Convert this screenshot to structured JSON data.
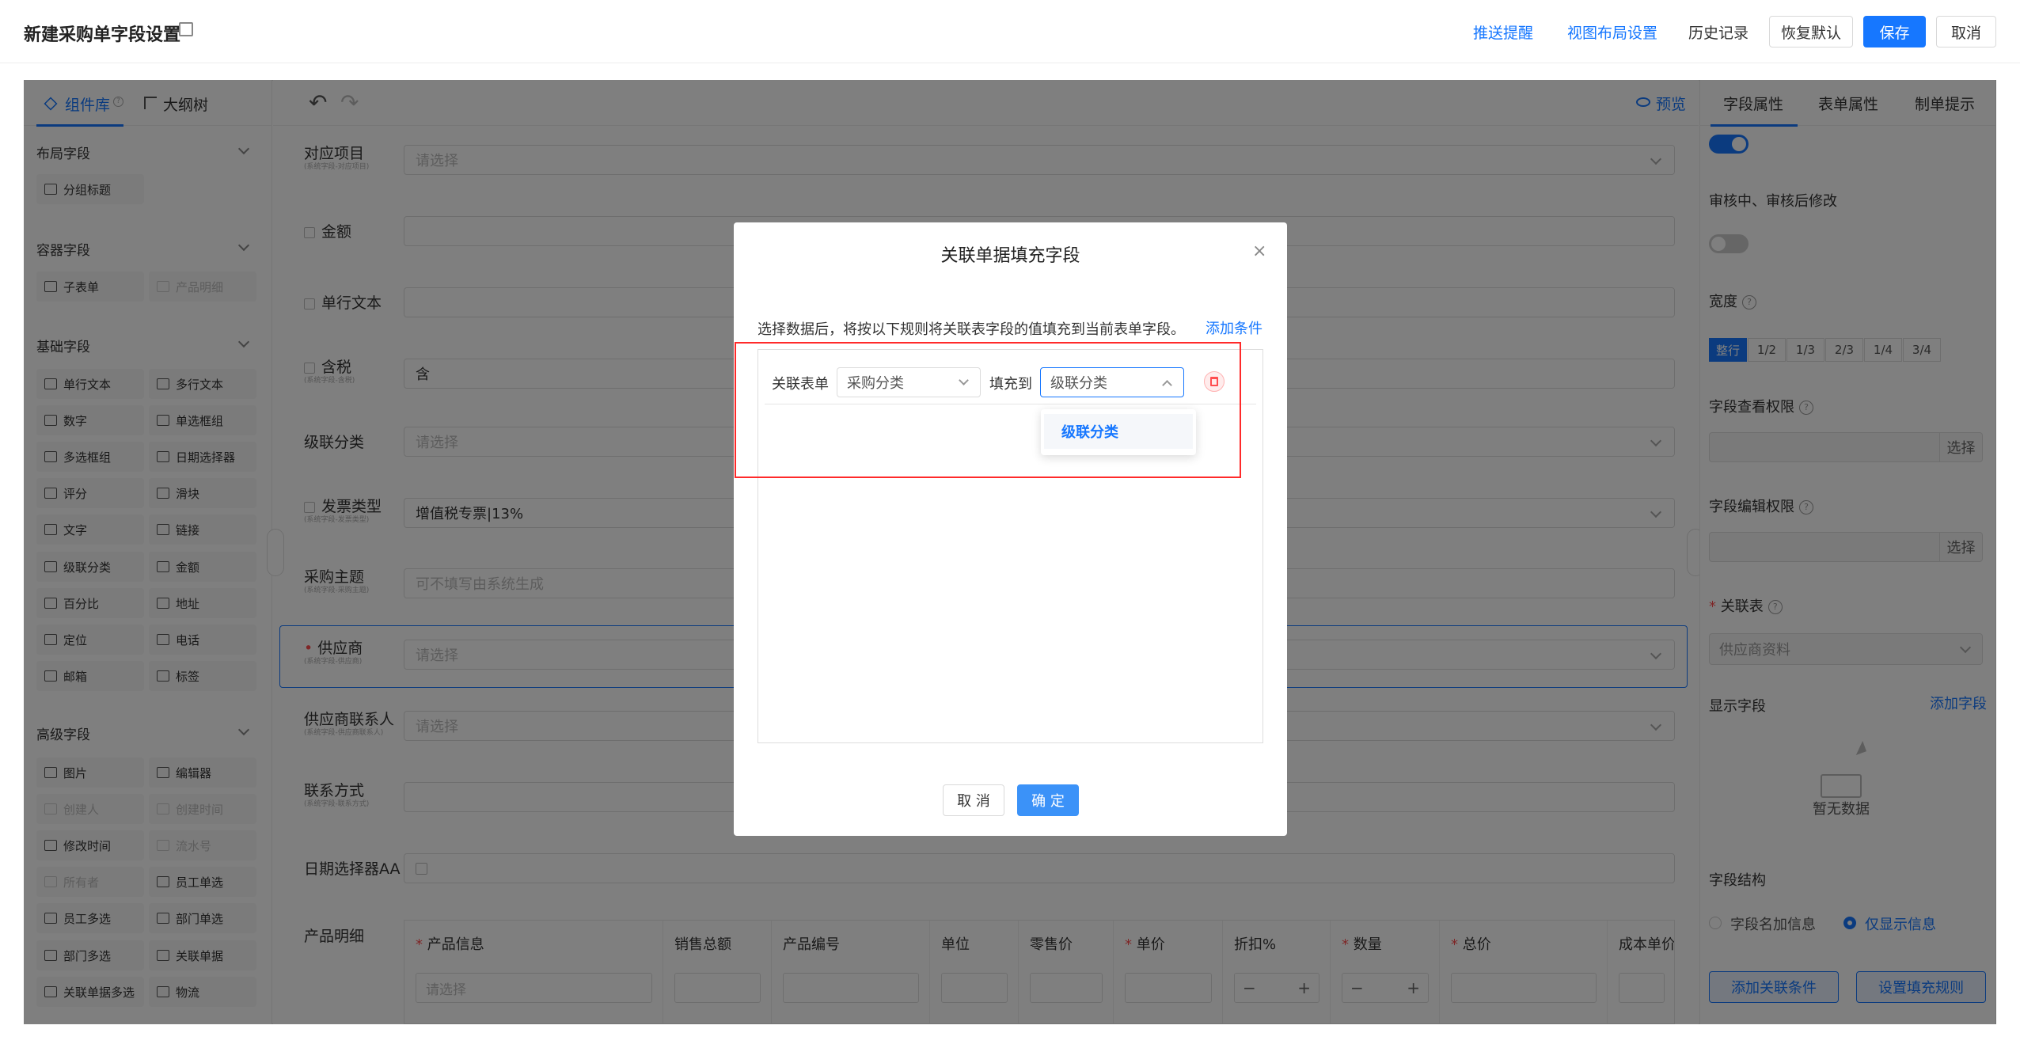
{
  "header": {
    "title": "新建采购单字段设置",
    "push": "推送提醒",
    "view_layout": "视图布局设置",
    "history": "历史记录",
    "restore": "恢复默认",
    "save": "保存",
    "cancel": "取消"
  },
  "left": {
    "tab_components": "组件库",
    "tab_outline": "大纲树",
    "sections": [
      {
        "title": "布局字段",
        "items": [
          {
            "label": "分组标题",
            "disabled": false
          }
        ]
      },
      {
        "title": "容器字段",
        "items": [
          {
            "label": "子表单",
            "disabled": false
          },
          {
            "label": "产品明细",
            "disabled": true
          }
        ]
      },
      {
        "title": "基础字段",
        "items": [
          {
            "label": "单行文本",
            "disabled": false
          },
          {
            "label": "多行文本",
            "disabled": false
          },
          {
            "label": "数字",
            "disabled": false
          },
          {
            "label": "单选框组",
            "disabled": false
          },
          {
            "label": "多选框组",
            "disabled": false
          },
          {
            "label": "日期选择器",
            "disabled": false
          },
          {
            "label": "评分",
            "disabled": false
          },
          {
            "label": "滑块",
            "disabled": false
          },
          {
            "label": "文字",
            "disabled": false
          },
          {
            "label": "链接",
            "disabled": false
          },
          {
            "label": "级联分类",
            "disabled": false
          },
          {
            "label": "金额",
            "disabled": false
          },
          {
            "label": "百分比",
            "disabled": false
          },
          {
            "label": "地址",
            "disabled": false
          },
          {
            "label": "定位",
            "disabled": false
          },
          {
            "label": "电话",
            "disabled": false
          },
          {
            "label": "邮箱",
            "disabled": false
          },
          {
            "label": "标签",
            "disabled": false
          }
        ]
      },
      {
        "title": "高级字段",
        "items": [
          {
            "label": "图片",
            "disabled": false
          },
          {
            "label": "编辑器",
            "disabled": false
          },
          {
            "label": "创建人",
            "disabled": true
          },
          {
            "label": "创建时间",
            "disabled": true
          },
          {
            "label": "修改时间",
            "disabled": false
          },
          {
            "label": "流水号",
            "disabled": true
          },
          {
            "label": "所有者",
            "disabled": true
          },
          {
            "label": "员工单选",
            "disabled": false
          },
          {
            "label": "员工多选",
            "disabled": false
          },
          {
            "label": "部门单选",
            "disabled": false
          },
          {
            "label": "部门多选",
            "disabled": false
          },
          {
            "label": "关联单据",
            "disabled": false
          },
          {
            "label": "关联单据多选",
            "disabled": false
          },
          {
            "label": "物流",
            "disabled": false
          }
        ]
      }
    ]
  },
  "canvas": {
    "preview": "预览",
    "fields": [
      {
        "label": "对应项目",
        "sub": "(系统字段-对应项目)",
        "value": "请选择",
        "placeholder": true,
        "select": true,
        "locked": false
      },
      {
        "label": "金额",
        "sub": "",
        "value": "",
        "placeholder": true,
        "select": false,
        "locked": true
      },
      {
        "label": "单行文本",
        "sub": "",
        "value": "",
        "placeholder": true,
        "select": false,
        "locked": true
      },
      {
        "label": "含税",
        "sub": "(系统字段-含税)",
        "value": "含",
        "placeholder": false,
        "select": false,
        "locked": true
      },
      {
        "label": "级联分类",
        "sub": "",
        "value": "请选择",
        "placeholder": true,
        "select": true,
        "locked": false
      },
      {
        "label": "发票类型",
        "sub": "(系统字段-发票类型)",
        "value": "增值税专票|13%",
        "placeholder": false,
        "select": true,
        "locked": true
      },
      {
        "label": "采购主题",
        "sub": "(系统字段-采购主题)",
        "value": "可不填写由系统生成",
        "placeholder": true,
        "select": false,
        "locked": false
      },
      {
        "label": "供应商",
        "sub": "(系统字段-供应商)",
        "value": "请选择",
        "placeholder": true,
        "select": true,
        "locked": false,
        "required": true
      },
      {
        "label": "供应商联系人",
        "sub": "(系统字段-供应商联系人)",
        "value": "请选择",
        "placeholder": true,
        "select": true,
        "locked": false
      },
      {
        "label": "联系方式",
        "sub": "(系统字段-联系方式)",
        "value": "",
        "placeholder": true,
        "select": false,
        "locked": false
      },
      {
        "label": "日期选择器AA",
        "sub": "",
        "value": "",
        "placeholder": true,
        "select": false,
        "locked": false
      }
    ],
    "product_label": "产品明细",
    "product_columns": [
      {
        "label": "产品信息",
        "required": true
      },
      {
        "label": "销售总额",
        "required": false
      },
      {
        "label": "产品编号",
        "required": false
      },
      {
        "label": "单位",
        "required": false
      },
      {
        "label": "零售价",
        "required": false
      },
      {
        "label": "单价",
        "required": true
      },
      {
        "label": "折扣%",
        "required": false
      },
      {
        "label": "数量",
        "required": true
      },
      {
        "label": "总价",
        "required": true
      },
      {
        "label": "成本单价",
        "required": false
      }
    ],
    "product_select_placeholder": "请选择"
  },
  "right": {
    "tabs": [
      "字段属性",
      "表单属性",
      "制单提示"
    ],
    "review_edit": "审核中、审核后修改",
    "width_label": "宽度",
    "widths": [
      "整行",
      "1/2",
      "1/3",
      "2/3",
      "1/4",
      "3/4"
    ],
    "view_perm": "字段查看权限",
    "edit_perm": "字段编辑权限",
    "choose": "选择",
    "rel_table": "关联表",
    "rel_table_value": "供应商资料",
    "display_fields": "显示字段",
    "add_field": "添加字段",
    "empty": "暂无数据",
    "structure": "字段结构",
    "opt_name": "字段名加信息",
    "opt_only": "仅显示信息",
    "add_rel_cond": "添加关联条件",
    "set_fill_rule": "设置填充规则"
  },
  "modal": {
    "title": "关联单据填充字段",
    "desc": "选择数据后，将按以下规则将关联表字段的值填充到当前表单字段。",
    "add_condition": "添加条件",
    "rel_form_label": "关联表单",
    "rel_form_value": "采购分类",
    "fill_to": "填充到",
    "fill_value": "级联分类",
    "option": "级联分类",
    "cancel": "取 消",
    "ok": "确 定"
  },
  "colors": {
    "primary": "#1677ff",
    "highlight_box": "#ff2a2a",
    "danger": "#ff4d4f",
    "overlay": "rgba(0,0,0,0.5)"
  }
}
